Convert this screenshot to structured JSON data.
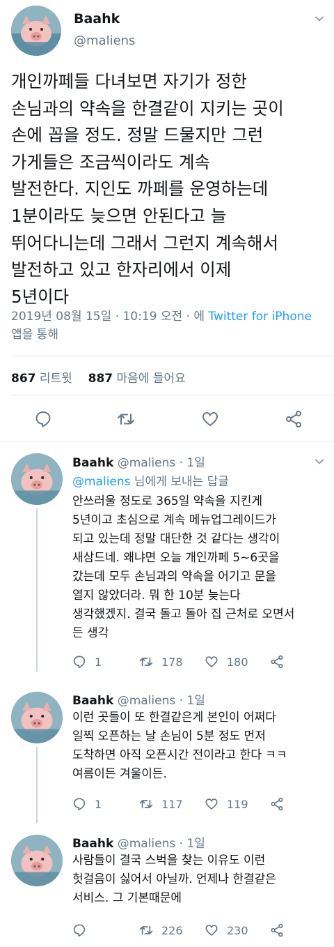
{
  "colors": {
    "text": "#14171a",
    "secondary": "#657786",
    "link": "#1da1f2",
    "divider": "#e1e8ed"
  },
  "main_tweet": {
    "display_name": "Baahk",
    "handle": "@maliens",
    "text": "개인까페들 다녀보면 자기가 정한\n손님과의 약속을 한결같이 지키는 곳이\n손에 꼽을 정도. 정말 드물지만 그런\n가게들은 조금씩이라도 계속\n발전한다. 지인도 까페를 운영하는데\n1분이라도 늦으면 안된다고 늘\n뛰어다니는데 그래서 그런지 계속해서\n발전하고 있고 한자리에서 이제\n5년이다",
    "timestamp": "2019년 08월 15일 · 10:19 오전 · 에 ",
    "source_link": "Twitter for iPhone",
    "source_suffix": " 앱을 통해",
    "retweets_count": "867",
    "retweets_label": " 리트윗",
    "likes_count": "887",
    "likes_label": " 마음에 들어요",
    "icons": [
      "reply-icon",
      "retweet-icon",
      "like-icon",
      "share-icon"
    ]
  },
  "replies": [
    {
      "display_name": "Baahk",
      "handle": "@maliens",
      "time": "1일",
      "reply_to_handle": "@maliens",
      "reply_to_suffix": " 님에게 보내는 답글",
      "text": "안쓰러울 정도로 365일 약속을 지킨게\n5년이고 초심으로 계속 메뉴업그레이드가\n되고 있는데 정말 대단한 것 같다는 생각이\n새삼드네. 왜냐면 오늘 개인까페 5~6곳을\n갔는데 모두 손님과의 약속을 어기고 문을\n열지 않았더라. 뭐 한 10분 늦는다\n생각했겠지. 결국 돌고 돌아 집 근처로 오면서\n든 생각",
      "reply_count": "1",
      "retweet_count": "178",
      "like_count": "180"
    },
    {
      "display_name": "Baahk",
      "handle": "@maliens",
      "time": "1일",
      "text": "이런 곳들이 또 한결같은게 본인이 어쩌다\n일찍 오픈하는 날 손님이 5분 정도 먼저\n도착하면 아직 오픈시간 전이라고 한다 ㅋㅋ\n여름이든 겨울이든.",
      "reply_count": "1",
      "retweet_count": "117",
      "like_count": "119"
    },
    {
      "display_name": "Baahk",
      "handle": "@maliens",
      "time": "1일",
      "text": "사람들이 결국 스벅을 찾는 이유도 이런\n헛걸음이 싫어서 아닐까. 언제나 한결같은\n서비스. 그 기본때문에",
      "reply_count": "",
      "retweet_count": "226",
      "like_count": "230"
    }
  ]
}
